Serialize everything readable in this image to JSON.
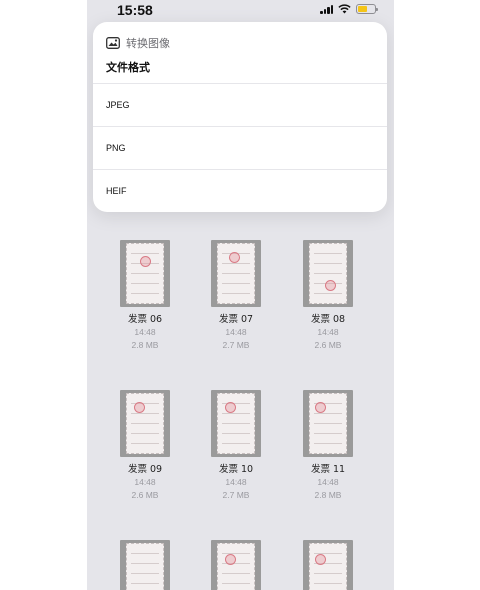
{
  "status_bar": {
    "time": "15:58",
    "icons": [
      "signal-icon",
      "wifi-icon",
      "battery-icon"
    ]
  },
  "menu": {
    "title": "转换图像",
    "title_icon": "image-convert-icon",
    "section_label": "文件格式",
    "options": [
      "JPEG",
      "PNG",
      "HEIF"
    ]
  },
  "files": [
    {
      "name": "发票 06",
      "time": "14:48",
      "size": "2.8 MB"
    },
    {
      "name": "发票 07",
      "time": "14:48",
      "size": "2.7 MB"
    },
    {
      "name": "发票 08",
      "time": "14:48",
      "size": "2.6 MB"
    },
    {
      "name": "发票 09",
      "time": "14:48",
      "size": "2.6 MB"
    },
    {
      "name": "发票 10",
      "time": "14:48",
      "size": "2.7 MB"
    },
    {
      "name": "发票 11",
      "time": "14:48",
      "size": "2.8 MB"
    },
    {
      "name": "",
      "time": "",
      "size": ""
    },
    {
      "name": "",
      "time": "",
      "size": ""
    },
    {
      "name": "",
      "time": "",
      "size": ""
    }
  ],
  "colors": {
    "background": "#e5e5ea",
    "menu_background": "#ffffff",
    "battery": "#f5c518",
    "stamp": "#d97a85"
  }
}
